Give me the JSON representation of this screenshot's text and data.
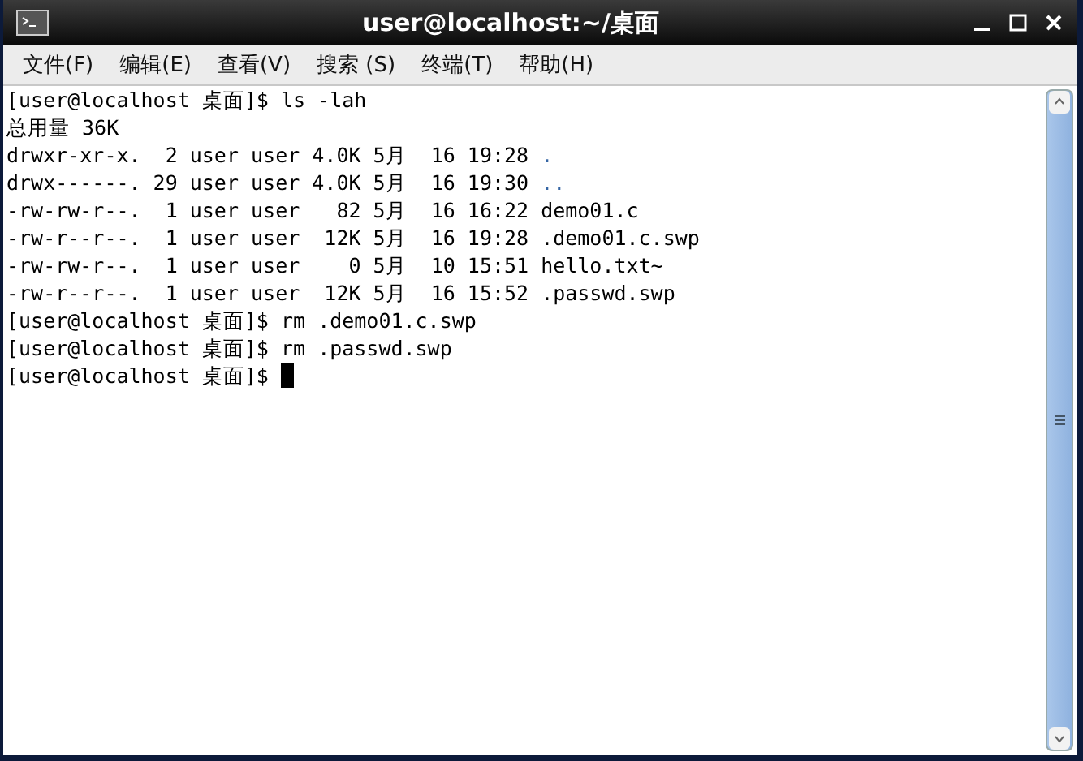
{
  "window": {
    "title": "user@localhost:~/桌面"
  },
  "menu": [
    {
      "label": "文件(F)"
    },
    {
      "label": "编辑(E)"
    },
    {
      "label": "查看(V)"
    },
    {
      "label": "搜索 (S)"
    },
    {
      "label": "终端(T)"
    },
    {
      "label": "帮助(H)"
    }
  ],
  "terminal": {
    "lines": [
      {
        "text": "[user@localhost 桌面]$ ls -lah"
      },
      {
        "text": "总用量 36K"
      },
      {
        "text": "drwxr-xr-x.  2 user user 4.0K 5月  16 19:28 ",
        "file": ".",
        "kind": "dir"
      },
      {
        "text": "drwx------. 29 user user 4.0K 5月  16 19:30 ",
        "file": "..",
        "kind": "dir"
      },
      {
        "text": "-rw-rw-r--.  1 user user   82 5月  16 16:22 ",
        "file": "demo01.c",
        "kind": "file"
      },
      {
        "text": "-rw-r--r--.  1 user user  12K 5月  16 19:28 ",
        "file": ".demo01.c.swp",
        "kind": "file"
      },
      {
        "text": "-rw-rw-r--.  1 user user    0 5月  10 15:51 ",
        "file": "hello.txt~",
        "kind": "file"
      },
      {
        "text": "-rw-r--r--.  1 user user  12K 5月  16 15:52 ",
        "file": ".passwd.swp",
        "kind": "file"
      },
      {
        "text": "[user@localhost 桌面]$ rm .demo01.c.swp"
      },
      {
        "text": "[user@localhost 桌面]$ rm .passwd.swp"
      },
      {
        "text": "[user@localhost 桌面]$ ",
        "cursor": true
      }
    ]
  }
}
